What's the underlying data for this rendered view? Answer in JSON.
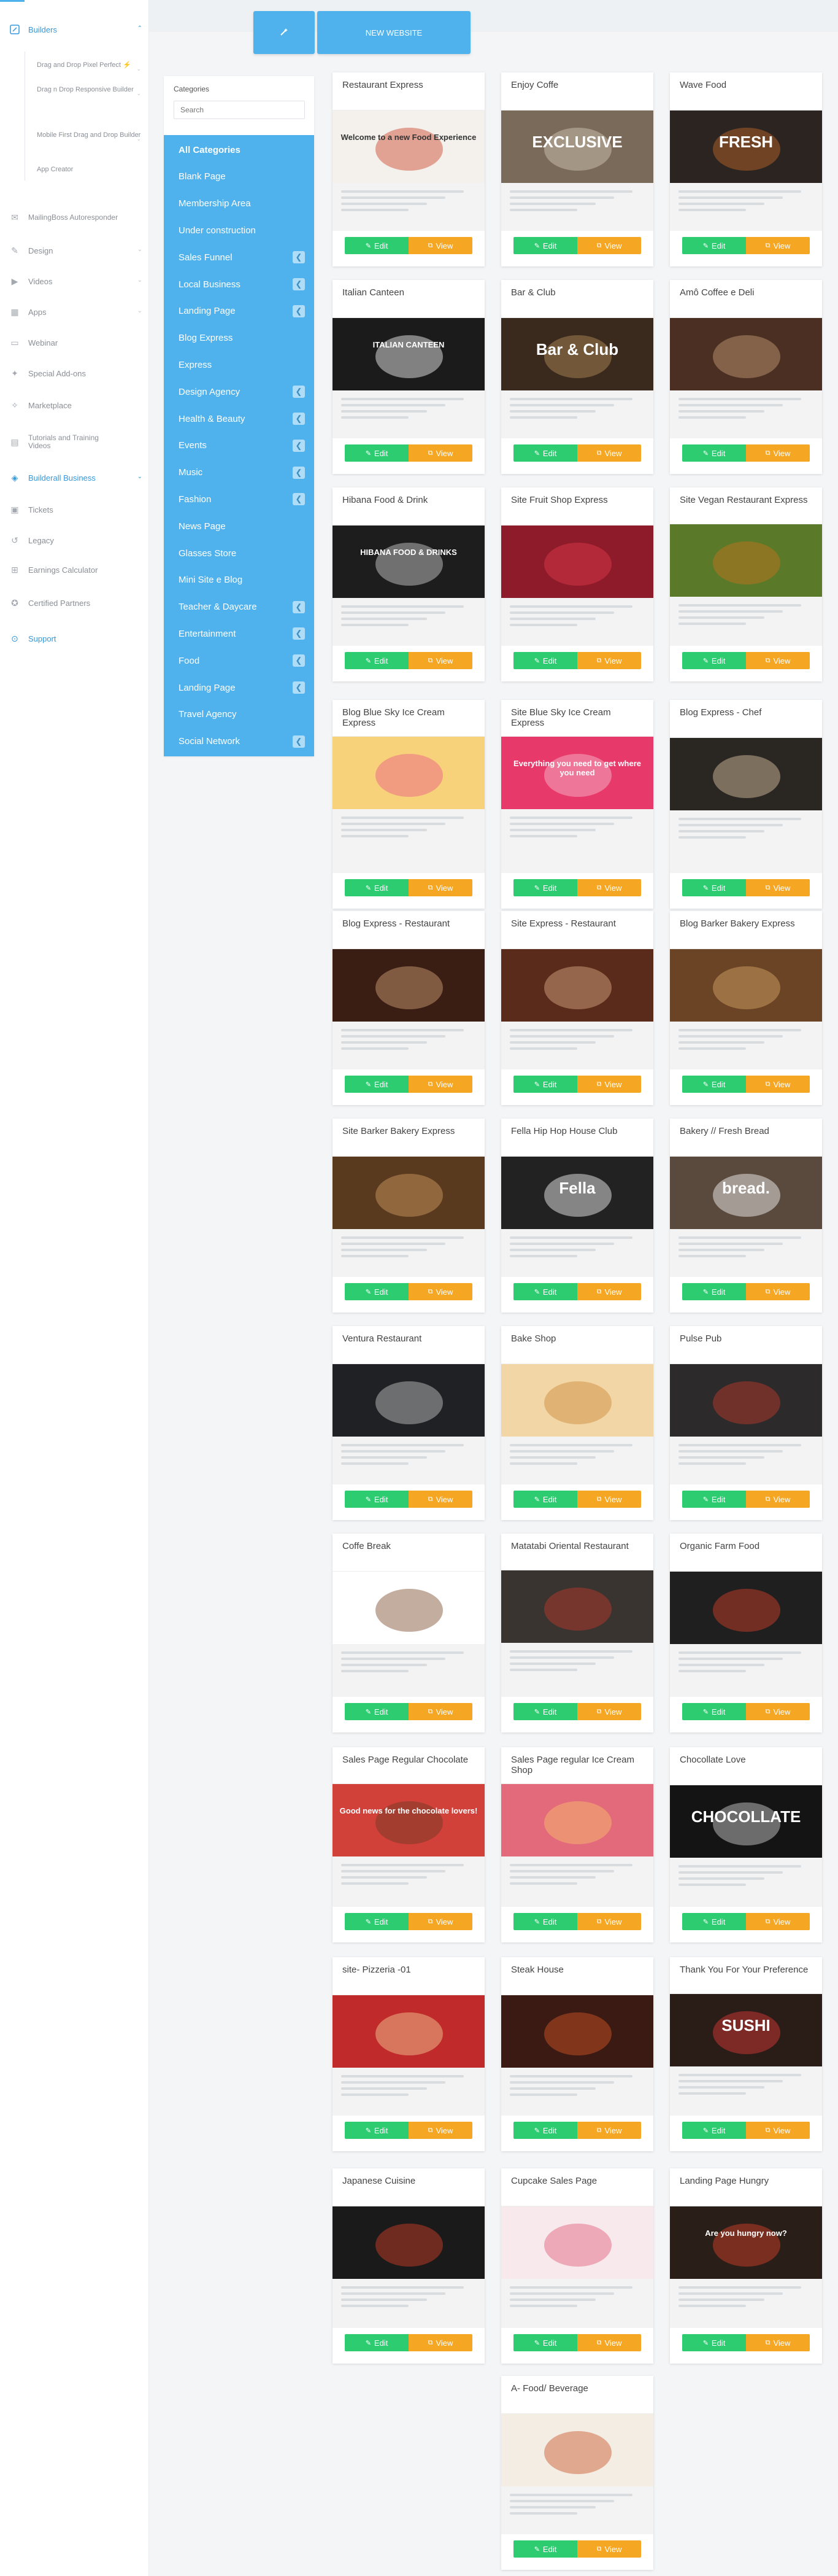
{
  "sidebar": {
    "builders_label": "Builders",
    "builder_subitems": [
      "Drag and Drop Pixel Perfect ⚡",
      "Drag n Drop Responsive Builder",
      "Mobile First Drag and Drop Builder",
      "App Creator"
    ],
    "items": [
      {
        "label": "MailingBoss Autoresponder",
        "icon": "envelope-icon"
      },
      {
        "label": "Design",
        "icon": "palette-icon"
      },
      {
        "label": "Videos",
        "icon": "video-icon"
      },
      {
        "label": "Apps",
        "icon": "apps-icon"
      },
      {
        "label": "Webinar",
        "icon": "webinar-icon"
      },
      {
        "label": "Special Add-ons",
        "icon": "addons-icon"
      },
      {
        "label": "Marketplace",
        "icon": "marketplace-icon"
      },
      {
        "label": "Tutorials and Training Videos",
        "icon": "training-icon"
      },
      {
        "label": "Builderall Business",
        "icon": "business-icon"
      },
      {
        "label": "Tickets",
        "icon": "ticket-icon"
      },
      {
        "label": "Legacy",
        "icon": "legacy-icon"
      },
      {
        "label": "Earnings Calculator",
        "icon": "calculator-icon"
      },
      {
        "label": "Certified Partners",
        "icon": "partners-icon"
      },
      {
        "label": "Support",
        "icon": "support-icon"
      }
    ]
  },
  "toolbar": {
    "wand_icon": "magic-wand-icon",
    "new_website_label": "NEW WEBSITE"
  },
  "categories": {
    "title": "Categories",
    "search_placeholder": "Search",
    "items": [
      {
        "label": "All Categories",
        "expandable": false
      },
      {
        "label": "Blank Page",
        "expandable": false
      },
      {
        "label": "Membership Area",
        "expandable": false
      },
      {
        "label": "Under construction",
        "expandable": false
      },
      {
        "label": "Sales Funnel",
        "expandable": true
      },
      {
        "label": "Local Business",
        "expandable": true
      },
      {
        "label": "Landing Page",
        "expandable": true
      },
      {
        "label": "Blog Express",
        "expandable": false
      },
      {
        "label": "Express",
        "expandable": false
      },
      {
        "label": "Design Agency",
        "expandable": true
      },
      {
        "label": "Health & Beauty",
        "expandable": true
      },
      {
        "label": "Events",
        "expandable": true
      },
      {
        "label": "Music",
        "expandable": true
      },
      {
        "label": "Fashion",
        "expandable": true
      },
      {
        "label": "News Page",
        "expandable": false
      },
      {
        "label": "Glasses Store",
        "expandable": false
      },
      {
        "label": "Mini Site e Blog",
        "expandable": false
      },
      {
        "label": "Teacher & Daycare",
        "expandable": true
      },
      {
        "label": "Entertainment",
        "expandable": true
      },
      {
        "label": "Food",
        "expandable": true
      },
      {
        "label": "Landing Page",
        "expandable": true
      },
      {
        "label": "Travel Agency",
        "expandable": false
      },
      {
        "label": "Social Network",
        "expandable": true
      }
    ]
  },
  "buttons": {
    "edit": "Edit",
    "view": "View"
  },
  "templates": [
    {
      "title": "Restaurant Express",
      "theme": "#f4f1ec",
      "accent": "#c9432b",
      "text": "Welcome to a new Food Experience"
    },
    {
      "title": "Enjoy Coffe",
      "theme": "#7a6a5a",
      "accent": "#d8cbb8",
      "text": "EXCLUSIVE"
    },
    {
      "title": "Wave Food",
      "theme": "#2b2420",
      "accent": "#c56a2a",
      "text": "FRESH"
    },
    {
      "title": "Italian Canteen",
      "theme": "#1b1b1b",
      "accent": "#ffffff",
      "text": "ITALIAN CANTEEN"
    },
    {
      "title": "Bar & Club",
      "theme": "#3a2a1e",
      "accent": "#b98d5a",
      "text": "Bar & Club"
    },
    {
      "title": "Amô Coffee e Deli",
      "theme": "#4a2f22",
      "accent": "#c9a27a",
      "text": ""
    },
    {
      "title": "Hibana Food & Drink",
      "theme": "#1d1d1d",
      "accent": "#d8d8d8",
      "text": "HIBANA FOOD & DRINKS"
    },
    {
      "title": "Site Fruit Shop Express",
      "theme": "#8e1b2a",
      "accent": "#e23b4b",
      "text": ""
    },
    {
      "title": "Site Vegan Restaurant Express",
      "theme": "#5a7a2a",
      "accent": "#c9721d",
      "text": ""
    },
    {
      "title": "Blog Blue Sky Ice Cream Express",
      "theme": "#f7d27a",
      "accent": "#e85a8a",
      "text": ""
    },
    {
      "title": "Site Blue Sky Ice Cream Express",
      "theme": "#e83a6a",
      "accent": "#f7c2d2",
      "text": "Everything you need to get where you need"
    },
    {
      "title": "Blog Express - Chef",
      "theme": "#2a2622",
      "accent": "#e0c9a8",
      "text": ""
    },
    {
      "title": "Blog Express - Restaurant",
      "theme": "#3a1e14",
      "accent": "#d9a47a",
      "text": ""
    },
    {
      "title": "Site Express - Restaurant",
      "theme": "#5a2a1a",
      "accent": "#e0b08a",
      "text": ""
    },
    {
      "title": "Blog Barker Bakery Express",
      "theme": "#6a4424",
      "accent": "#d9a86a",
      "text": ""
    },
    {
      "title": "Site Barker Bakery Express",
      "theme": "#5a3a1e",
      "accent": "#d4a064",
      "text": ""
    },
    {
      "title": "Fella Hip Hop House Club",
      "theme": "#222222",
      "accent": "#ffffff",
      "text": "Fella"
    },
    {
      "title": "Bakery // Fresh Bread",
      "theme": "#5a4a3e",
      "accent": "#ffffff",
      "text": "bread."
    },
    {
      "title": "Ventura Restaurant",
      "theme": "#1f2124",
      "accent": "#cccccc",
      "text": ""
    },
    {
      "title": "Bake Shop",
      "theme": "#f3d6a6",
      "accent": "#c98a3a",
      "text": ""
    },
    {
      "title": "Pulse Pub",
      "theme": "#2c2a2a",
      "accent": "#c0392b",
      "text": ""
    },
    {
      "title": "Coffe Break",
      "theme": "#ffffff",
      "accent": "#7a4a2a",
      "text": ""
    },
    {
      "title": "Matatabi Oriental Restaurant",
      "theme": "#3a3430",
      "accent": "#c0392b",
      "text": ""
    },
    {
      "title": "Organic Farm Food",
      "theme": "#1f1f1f",
      "accent": "#d9412b",
      "text": ""
    },
    {
      "title": "Sales Page Regular Chocolate",
      "theme": "#d2403a",
      "accent": "#6a3a24",
      "text": "Good news for the chocolate lovers!"
    },
    {
      "title": "Sales Page regular Ice Cream Shop",
      "theme": "#e36a7a",
      "accent": "#f7c26a",
      "text": ""
    },
    {
      "title": "Chocollate Love",
      "theme": "#141414",
      "accent": "#d8d8d8",
      "text": "CHOCOLLATE"
    },
    {
      "title": "site- Pizzeria -01",
      "theme": "#c02a2a",
      "accent": "#f3d29a",
      "text": ""
    },
    {
      "title": "Steak House",
      "theme": "#3a1a12",
      "accent": "#d9592b",
      "text": ""
    },
    {
      "title": "Thank You For Your Preference",
      "theme": "#2a1c16",
      "accent": "#e23b3b",
      "text": "SUSHI"
    },
    {
      "title": "Japanese Cuisine",
      "theme": "#1a1a1a",
      "accent": "#d9412b",
      "text": ""
    },
    {
      "title": "Cupcake Sales Page",
      "theme": "#f7e9ec",
      "accent": "#e25a7a",
      "text": ""
    },
    {
      "title": "Landing Page Hungry",
      "theme": "#2a1f18",
      "accent": "#d9412b",
      "text": "Are you hungry now?"
    },
    {
      "title": "A- Food/ Beverage",
      "theme": "#f4ede4",
      "accent": "#c9542a",
      "text": ""
    }
  ]
}
